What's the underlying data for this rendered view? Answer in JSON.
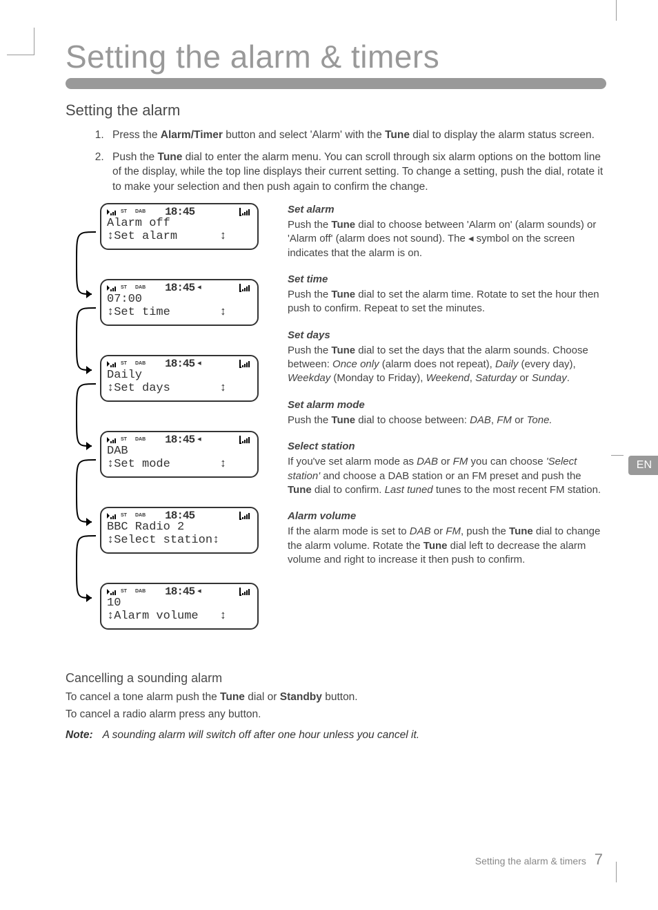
{
  "title": "Setting the alarm & timers",
  "section_heading": "Setting the alarm",
  "lang_tab": "EN",
  "steps": [
    "Press the <b>Alarm/Timer</b> button and select 'Alarm' with the <b>Tune</b> dial to display the alarm status screen.",
    "Push the <b>Tune</b> dial to enter the alarm menu. You can scroll through six alarm options on the bottom line of the display, while the top line displays their current setting. To change a setting, push the dial, rotate it to make your selection and then push again to confirm the change."
  ],
  "screens": [
    {
      "clock": "18:45",
      "bell": false,
      "line1": "Alarm off",
      "line2": "↕Set alarm      ↕"
    },
    {
      "clock": "18:45",
      "bell": true,
      "line1": "07:00",
      "line2": "↕Set time       ↕"
    },
    {
      "clock": "18:45",
      "bell": true,
      "line1": "Daily",
      "line2": "↕Set days       ↕"
    },
    {
      "clock": "18:45",
      "bell": true,
      "line1": "DAB",
      "line2": "↕Set mode       ↕"
    },
    {
      "clock": "18:45",
      "bell": false,
      "line1": "BBC Radio 2",
      "line2": "↕Select station↕"
    },
    {
      "clock": "18:45",
      "bell": true,
      "line1": "10",
      "line2": "↕Alarm volume   ↕"
    }
  ],
  "descriptions": [
    {
      "head": "Set alarm",
      "body": "Push the <b>Tune</b> dial to choose between 'Alarm on' (alarm sounds) or 'Alarm off' (alarm does not sound). The ◂ symbol on the screen indicates that the alarm is on."
    },
    {
      "head": "Set time",
      "body": "Push the <b>Tune</b> dial to set the alarm time. Rotate to set the hour then push to confirm. Repeat to set the minutes."
    },
    {
      "head": "Set days",
      "body": "Push the <b>Tune</b> dial to set the days that the alarm sounds. Choose between: <i>Once only</i> (alarm does not repeat), <i>Daily</i> (every day), <i>Weekday</i> (Monday to Friday), <i>Weekend</i>, <i>Saturday</i> or <i>Sunday</i>."
    },
    {
      "head": "Set alarm mode",
      "body": "Push the <b>Tune</b> dial to choose between: <i>DAB</i>, <i>FM</i> or <i>Tone.</i>"
    },
    {
      "head": "Select station",
      "body": "If you've set alarm mode as <i>DAB</i> or <i>FM</i> you can choose <i>'Select station'</i> and choose a DAB station or an FM preset and push the <b>Tune</b> dial to confirm. <i>Last tuned</i> tunes to the most recent FM station."
    },
    {
      "head": "Alarm volume",
      "body": "If the alarm mode is set to <i>DAB</i> or <i>FM</i>, push the <b>Tune</b> dial to change the alarm volume. Rotate the <b>Tune</b> dial left to decrease the alarm volume and right to increase it then push to confirm."
    }
  ],
  "cancelling": {
    "heading": "Cancelling a sounding alarm",
    "p1": "To cancel a tone alarm push the <b>Tune</b> dial or <b>Standby</b> button.",
    "p2": "To cancel a radio alarm press any button.",
    "note_label": "Note:",
    "note_text": "A sounding alarm will switch off after one hour unless you cancel it."
  },
  "footer": {
    "text": "Setting the alarm & timers",
    "page": "7"
  },
  "icons": {
    "st_label": "ST",
    "dab_label": "DAB"
  }
}
